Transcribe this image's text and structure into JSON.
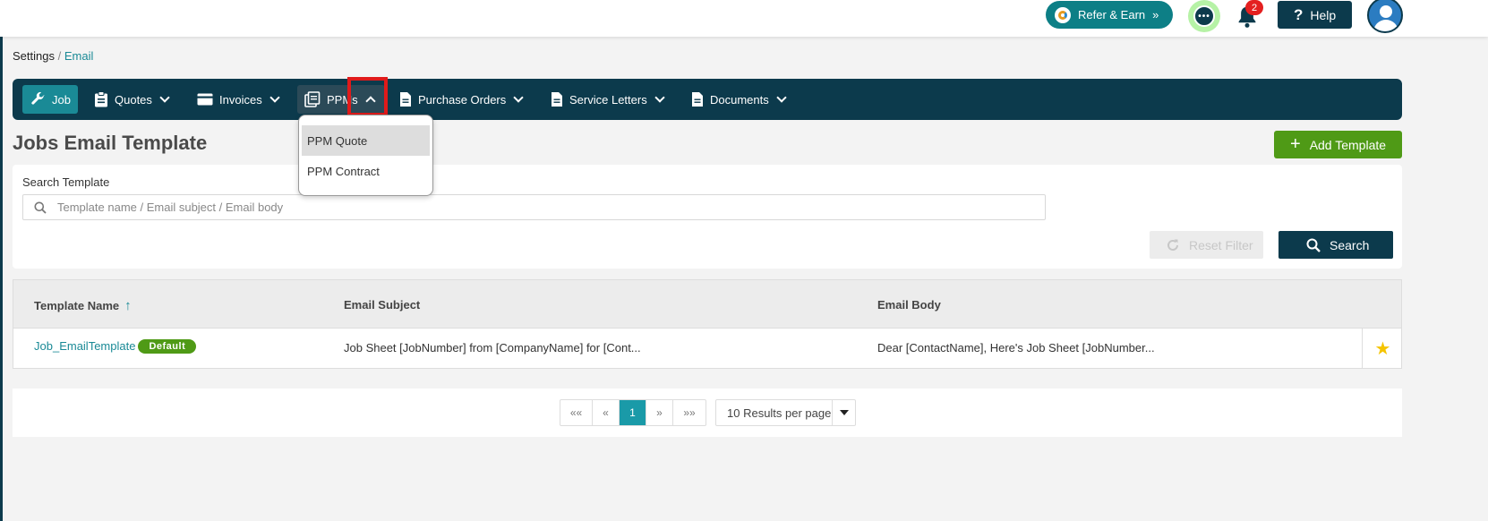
{
  "header": {
    "refer_label": "Refer & Earn",
    "refer_arrow": "»",
    "notifications_count": "2",
    "help_label": "Help"
  },
  "breadcrumb": {
    "root": "Settings",
    "separator": "/",
    "current": "Email"
  },
  "nav": {
    "items": [
      {
        "label": "Job",
        "icon": "wrench-icon",
        "active": true
      },
      {
        "label": "Quotes",
        "icon": "clipboard-icon"
      },
      {
        "label": "Invoices",
        "icon": "card-icon"
      },
      {
        "label": "PPMs",
        "icon": "stack-icon",
        "open": true
      },
      {
        "label": "Purchase Orders",
        "icon": "document-icon"
      },
      {
        "label": "Service Letters",
        "icon": "document-icon"
      },
      {
        "label": "Documents",
        "icon": "document-icon"
      }
    ]
  },
  "dropdown": {
    "items": [
      "PPM Quote",
      "PPM Contract"
    ]
  },
  "page": {
    "title": "Jobs Email Template",
    "add_button": "Add Template"
  },
  "filter": {
    "label": "Search Template",
    "placeholder": "Template name / Email subject / Email body",
    "reset_label": "Reset Filter",
    "search_label": "Search"
  },
  "table": {
    "columns": [
      "Template Name",
      "Email Subject",
      "Email Body"
    ],
    "rows": [
      {
        "name": "Job_EmailTemplate",
        "badge": "Default",
        "subject": "Job Sheet [JobNumber] from [CompanyName] for [Cont...",
        "body": "Dear [ContactName], Here's Job Sheet [JobNumber...",
        "starred": true
      }
    ]
  },
  "pagination": {
    "first": "««",
    "prev": "«",
    "current": "1",
    "next": "»",
    "last": "»»",
    "per_page": "10 Results per page"
  },
  "colors": {
    "primary_dark": "#0c3a4c",
    "accent_teal": "#1a8a96",
    "success_green": "#4f9a16",
    "highlight_red": "#e01a1a",
    "star_yellow": "#f5c400"
  }
}
